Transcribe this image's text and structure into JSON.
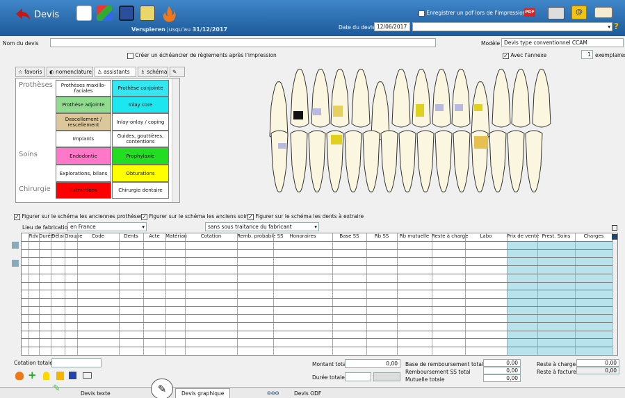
{
  "titlebar": {
    "title": "Devis",
    "version_brand": "Verspieren",
    "version_mid": " jusqu'au ",
    "version_date": "31/12/2017",
    "pdf_label": "Enregistrer un pdf lors de l'impression",
    "pdf_checked": "✓",
    "date_label": "Date du devis :",
    "date_value": "12/06/2017",
    "help": "?"
  },
  "form": {
    "name_label": "Nom du devis",
    "modele_label": "Modèle",
    "modele_value": "Devis type conventionnel CCAM",
    "echeancier_label": "Créer un échéancier de règlements après l'impression",
    "annexe_label": "Avec l'annexe",
    "annexe_checked": "✓",
    "copies_value": "1",
    "copies_label": "exemplaires"
  },
  "tabs": [
    "favoris",
    "nomenclature",
    "assistants",
    "schéma"
  ],
  "categories": [
    "Prothèses",
    "Soins",
    "Chirurgie"
  ],
  "assist": [
    {
      "label": "Prothèses maxillo-faciales",
      "color": "#ffffff"
    },
    {
      "label": "Prothèse conjointe",
      "color": "#33e6f0"
    },
    {
      "label": "Prothèse adjointe",
      "color": "#8fdc8f"
    },
    {
      "label": "Inlay core",
      "color": "#1ce6f0"
    },
    {
      "label": "Descellement / rescellement",
      "color": "#dcc79a"
    },
    {
      "label": "Inlay-onlay / coping",
      "color": "#ffffff"
    },
    {
      "label": "Implants",
      "color": "#ffffff"
    },
    {
      "label": "Guides, gouttières, contentions",
      "color": "#ffffff"
    },
    {
      "label": "Endodontie",
      "color": "#ff77c8"
    },
    {
      "label": "Prophylaxie",
      "color": "#22dd22"
    },
    {
      "label": "Explorations, bilans",
      "color": "#ffffff"
    },
    {
      "label": "Obturations",
      "color": "#ffff00"
    },
    {
      "label": "Extractions",
      "color": "#ff0000"
    },
    {
      "label": "Chirurgie dentaire",
      "color": "#ffffff"
    }
  ],
  "options": {
    "opt1": "Figurer sur le schéma les anciennes prothèses",
    "opt2": "Figurer sur le schéma les anciens soins",
    "opt3": "Figurer sur le schéma les dents à extraire",
    "checked": "✓",
    "lieu_label": "Lieu de fabrication",
    "lieu_value": "en France",
    "traitance_value": "sans sous traitance du fabricant"
  },
  "grid": {
    "headers": [
      "Rdv",
      "Durée",
      "Délai",
      "Groupe",
      "Code",
      "Dents",
      "Acte",
      "Matériau",
      "Cotation",
      "Remb. probable SS",
      "Honoraires",
      "Base SS",
      "Rb SS",
      "Rb mutuelle",
      "Reste à charge",
      "Labo",
      "Prix de vente",
      "Prest. Soins",
      "Charges"
    ]
  },
  "totals": {
    "cotation_label": "Cotation totale:",
    "montant_label": "Montant total",
    "montant_value": "0,00",
    "duree_label": "Durée totale",
    "base_label": "Base de remboursement totale",
    "base_value": "0,00",
    "rss_label": "Remboursement SS total",
    "rss_value": "0,00",
    "mut_label": "Mutuelle totale",
    "mut_value": "0,00",
    "reste_label": "Reste à charge",
    "reste_value": "0,00",
    "facturer_label": "Reste à facturer",
    "facturer_value": "0,00"
  },
  "bottom_tabs": [
    "Devis texte",
    "Devis graphique",
    "Devis ODF"
  ],
  "icons": [
    "back-arrow-icon",
    "new-document-icon",
    "cube-icon",
    "save-icon",
    "edit-icon",
    "fire-icon",
    "pdf-icon",
    "printer-icon",
    "email-icon",
    "book-icon"
  ]
}
